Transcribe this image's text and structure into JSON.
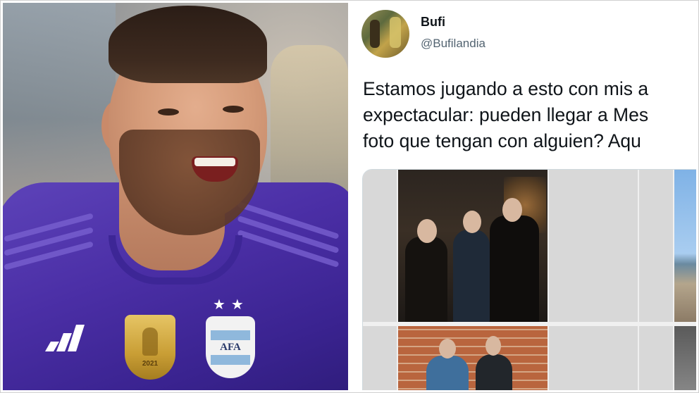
{
  "tweet": {
    "display_name": "Bufi",
    "handle": "@Bufilandia",
    "text_lines": [
      "Estamos jugando a esto con mis a",
      "expectacular: pueden llegar a Mes",
      "foto que tengan con alguien? Aqu"
    ]
  },
  "left_photo": {
    "badge_text": "2021",
    "crest_text": "AFA",
    "stars": "★★"
  },
  "colors": {
    "jersey": "#4b2fa6",
    "text_primary": "#0f1419",
    "text_secondary": "#536471",
    "media_border": "#cfd9de"
  },
  "icons": {
    "share": "share-arrow-icon",
    "brand_logo": "three-stripes-logo"
  }
}
